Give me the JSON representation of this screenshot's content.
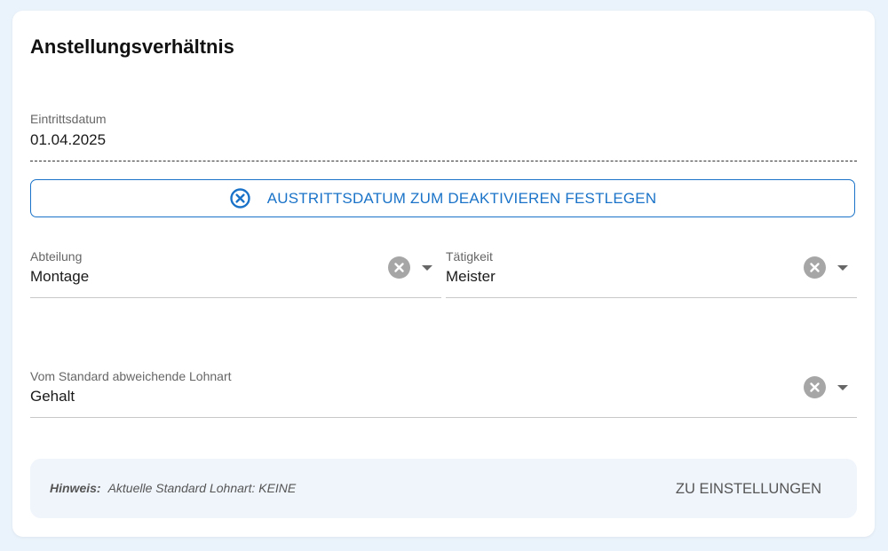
{
  "section": {
    "title": "Anstellungsverhältnis"
  },
  "entry_date": {
    "label": "Eintrittsdatum",
    "value": "01.04.2025"
  },
  "exit_button": {
    "icon": "circle-x-icon",
    "label": "AUSTRITTSDATUM ZUM DEAKTIVIEREN FESTLEGEN",
    "color": "#1a73c8"
  },
  "department": {
    "label": "Abteilung",
    "value": "Montage"
  },
  "activity": {
    "label": "Tätigkeit",
    "value": "Meister"
  },
  "wage_type": {
    "label": "Vom Standard abweichende Lohnart",
    "value": "Gehalt"
  },
  "hint": {
    "prefix": "Hinweis:",
    "text": "Aktuelle Standard Lohnart: KEINE",
    "link_label": "ZU EINSTELLUNGEN"
  }
}
